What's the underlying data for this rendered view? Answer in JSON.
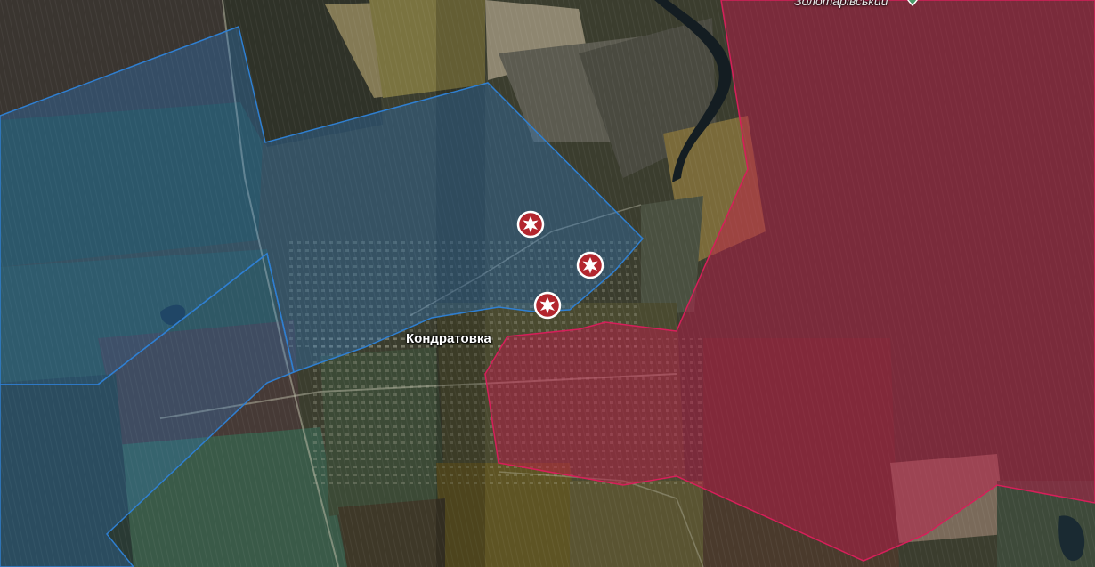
{
  "map": {
    "place_label": "Кондратовка",
    "top_label": "Золотарівський",
    "incidents": [
      {
        "type": "explosion-marker"
      },
      {
        "type": "explosion-marker"
      },
      {
        "type": "explosion-marker"
      }
    ],
    "zones": [
      {
        "name": "blue-controlled-area",
        "color": "#2f7fd1"
      },
      {
        "name": "red-controlled-area",
        "color": "#c8164c"
      }
    ],
    "colors": {
      "marker_fill": "#b3262e",
      "marker_border": "#ffffff",
      "water": "#141d22",
      "road": "#b9b9a6"
    }
  }
}
